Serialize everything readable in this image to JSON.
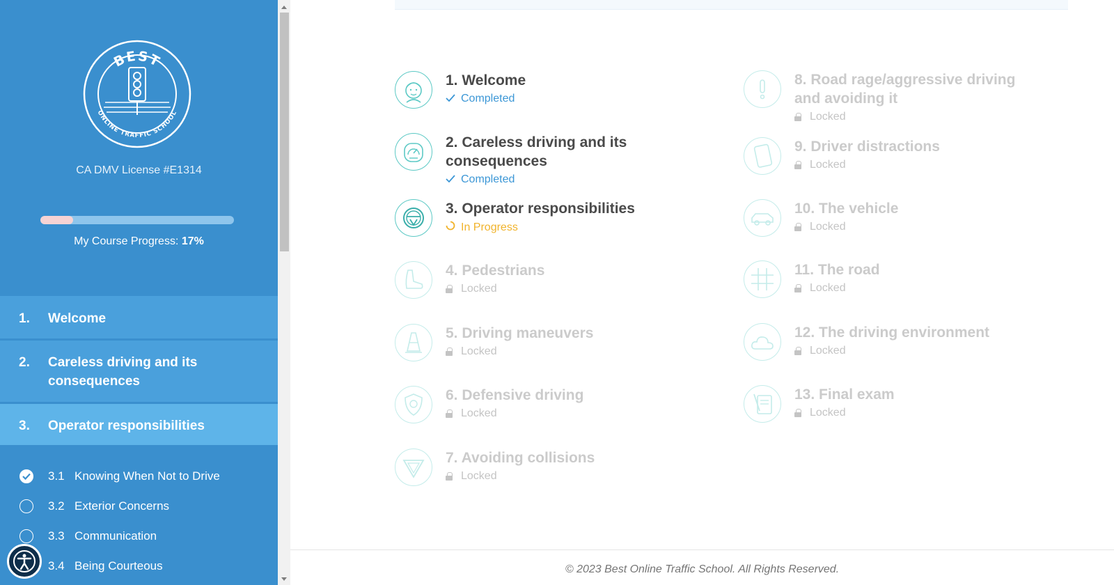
{
  "sidebar": {
    "logo": {
      "top_text": "BEST",
      "bottom_text": "ONLINE TRAFFIC SCHOOL"
    },
    "license": "CA DMV License #E1314",
    "progress": {
      "label": "My Course Progress:",
      "value_text": "17%",
      "fraction": 0.17
    },
    "nav": [
      {
        "num": "1.",
        "label": "Welcome"
      },
      {
        "num": "2.",
        "label": "Careless driving and its consequences"
      },
      {
        "num": "3.",
        "label": "Operator responsibilities"
      }
    ],
    "subitems": [
      {
        "num": "3.1",
        "label": "Knowing When Not to Drive",
        "done": true
      },
      {
        "num": "3.2",
        "label": "Exterior Concerns",
        "done": false
      },
      {
        "num": "3.3",
        "label": "Communication",
        "done": false
      },
      {
        "num": "3.4",
        "label": "Being Courteous",
        "done": false
      }
    ]
  },
  "lessons": [
    {
      "title": "1. Welcome",
      "status": "Completed",
      "state": "completed",
      "icon": "face-icon"
    },
    {
      "title": "2. Careless driving and its consequences",
      "status": "Completed",
      "state": "completed",
      "icon": "speedometer-icon"
    },
    {
      "title": "3. Operator responsibilities",
      "status": "In Progress",
      "state": "progress",
      "icon": "steering-wheel-icon"
    },
    {
      "title": "4. Pedestrians",
      "status": "Locked",
      "state": "locked",
      "icon": "shoe-icon"
    },
    {
      "title": "5. Driving maneuvers",
      "status": "Locked",
      "state": "locked",
      "icon": "traffic-cone-icon"
    },
    {
      "title": "6. Defensive driving",
      "status": "Locked",
      "state": "locked",
      "icon": "shield-icon"
    },
    {
      "title": "7. Avoiding collisions",
      "status": "Locked",
      "state": "locked",
      "icon": "yield-sign-icon"
    },
    {
      "title": "8. Road rage/aggressive driving and avoiding it",
      "status": "Locked",
      "state": "locked",
      "icon": "exclamation-icon"
    },
    {
      "title": "9. Driver distractions",
      "status": "Locked",
      "state": "locked",
      "icon": "phone-icon"
    },
    {
      "title": "10. The vehicle",
      "status": "Locked",
      "state": "locked",
      "icon": "car-icon"
    },
    {
      "title": "11. The road",
      "status": "Locked",
      "state": "locked",
      "icon": "road-icon"
    },
    {
      "title": "12. The driving environment",
      "status": "Locked",
      "state": "locked",
      "icon": "cloud-icon"
    },
    {
      "title": "13. Final exam",
      "status": "Locked",
      "state": "locked",
      "icon": "exam-icon"
    }
  ],
  "footer": {
    "text": "© 2023 Best Online Traffic School. All Rights Reserved."
  },
  "colors": {
    "sidebar": "#3a8fce",
    "nav": "#4aa0dc",
    "nav_active": "#5eb4e9",
    "teal": "#5cc9c5",
    "completed": "#3c97d6",
    "in_progress": "#f1b32b",
    "locked": "#cbcbcb"
  }
}
